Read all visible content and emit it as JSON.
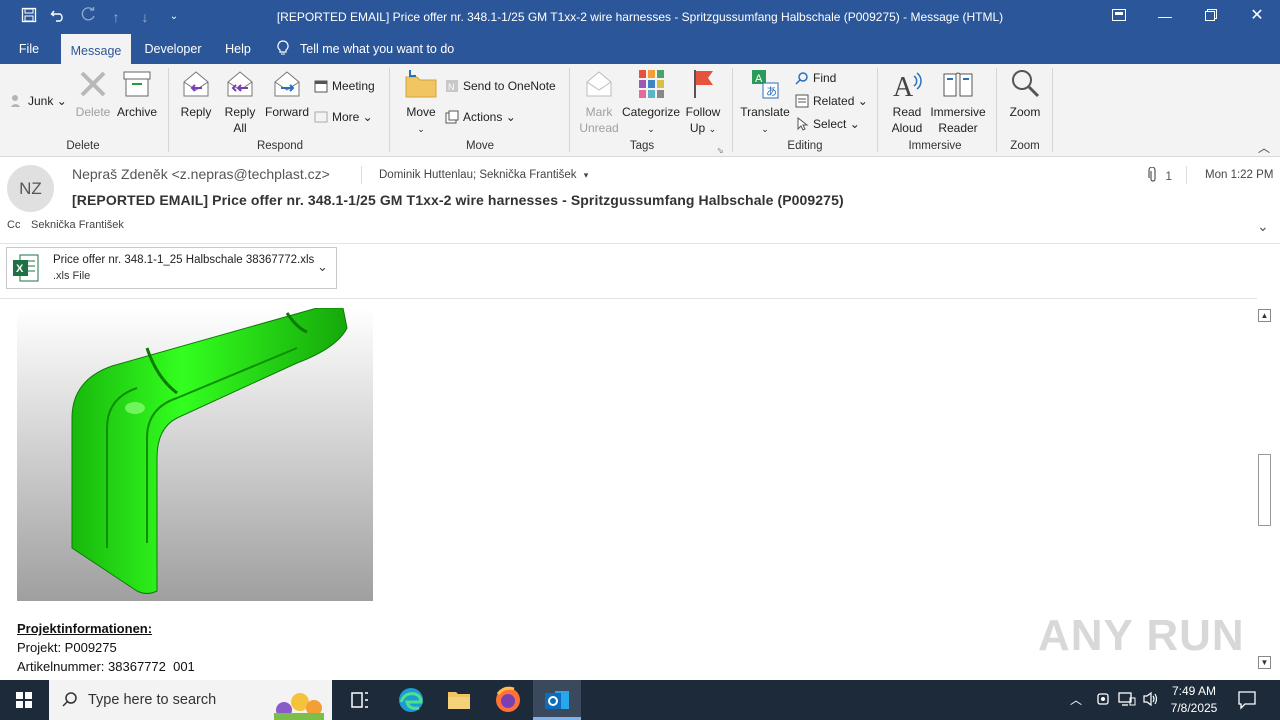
{
  "window": {
    "title": "[REPORTED EMAIL] Price offer nr. 348.1-1/25 GM T1xx-2 wire harnesses - Spritzgussumfang Halbschale (P009275)  -  Message (HTML)"
  },
  "tabs": [
    "File",
    "Message",
    "Developer",
    "Help",
    "Tell me what you want to do"
  ],
  "ribbon": {
    "delete": {
      "junk": "Junk",
      "delete": "Delete",
      "archive": "Archive",
      "label": "Delete"
    },
    "respond": {
      "reply": "Reply",
      "reply_all_1": "Reply",
      "reply_all_2": "All",
      "forward": "Forward",
      "meeting": "Meeting",
      "more": "More",
      "label": "Respond"
    },
    "move": {
      "move": "Move",
      "onenote": "Send to OneNote",
      "actions": "Actions",
      "label": "Move"
    },
    "tags": {
      "mark_1": "Mark",
      "mark_2": "Unread",
      "categorize": "Categorize",
      "follow_1": "Follow",
      "follow_2": "Up",
      "label": "Tags"
    },
    "editing": {
      "translate": "Translate",
      "find": "Find",
      "related": "Related",
      "select": "Select",
      "label": "Editing"
    },
    "immersive": {
      "read_1": "Read",
      "read_2": "Aloud",
      "imm_1": "Immersive",
      "imm_2": "Reader",
      "label": "Immersive"
    },
    "zoom": {
      "zoom": "Zoom",
      "label": "Zoom"
    }
  },
  "message": {
    "avatar": "NZ",
    "sender": "Nepraš Zdeněk <z.nepras@techplast.cz>",
    "to": "Dominik Huttenlau; Seknička František",
    "attach_count": "1",
    "time": "Mon 1:22 PM",
    "subject": "[REPORTED EMAIL] Price offer nr. 348.1-1/25 GM T1xx-2 wire harnesses - Spritzgussumfang Halbschale (P009275)",
    "cc_label": "Cc",
    "cc": "Seknička František"
  },
  "attachment": {
    "name": "Price offer nr. 348.1-1_25 Halbschale 38367772.xls",
    "type": ".xls File"
  },
  "body": {
    "heading": "Projektinformationen:",
    "line1": "Projekt: P009275",
    "line2": "Artikelnummer: 38367772  001"
  },
  "watermark": "ANY RUN",
  "taskbar": {
    "search_placeholder": "Type here to search",
    "time": "7:49 AM",
    "date": "7/8/2025"
  },
  "colors": {
    "accent": "#2b579a",
    "ribbon": "#f3f3f3",
    "taskbar": "#1c2a3a",
    "part": "#22dd11"
  }
}
